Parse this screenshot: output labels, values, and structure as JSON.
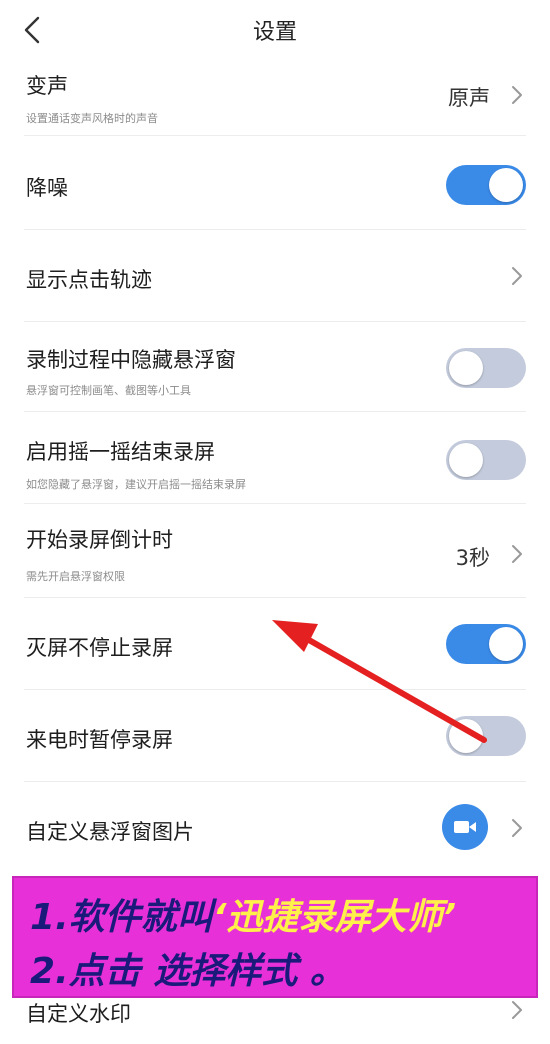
{
  "header": {
    "title": "设置"
  },
  "settings": {
    "voice_change": {
      "label": "变声",
      "sub": "设置通话变声风格时的声音",
      "value": "原声"
    },
    "noise_reduction": {
      "label": "降噪",
      "state": "on"
    },
    "show_touches": {
      "label": "显示点击轨迹"
    },
    "hide_floating": {
      "label": "录制过程中隐藏悬浮窗",
      "sub": "悬浮窗可控制画笔、截图等小工具",
      "state": "off"
    },
    "shake_stop": {
      "label": "启用摇一摇结束录屏",
      "sub": "如您隐藏了悬浮窗，建议开启摇一摇结束录屏",
      "state": "off"
    },
    "countdown": {
      "label": "开始录屏倒计时",
      "sub": "需先开启悬浮窗权限",
      "value": "3秒"
    },
    "screen_off": {
      "label": "灭屏不停止录屏",
      "state": "on"
    },
    "call_pause": {
      "label": "来电时暂停录屏",
      "state": "off"
    },
    "custom_float_image": {
      "label": "自定义悬浮窗图片"
    },
    "custom_watermark": {
      "label": "自定义水印"
    }
  },
  "banner": {
    "line1_prefix": "1.软件就叫",
    "line1_highlight": "‘迅捷录屏大师’",
    "line2": "2.点击 选择样式 。"
  },
  "colors": {
    "accent": "#3a8ae8",
    "toggle_off": "#c3cbdc",
    "banner_bg": "#e830d8",
    "banner_text": "#1a1a7a",
    "banner_highlight": "#fff04a",
    "arrow": "#e52020"
  }
}
